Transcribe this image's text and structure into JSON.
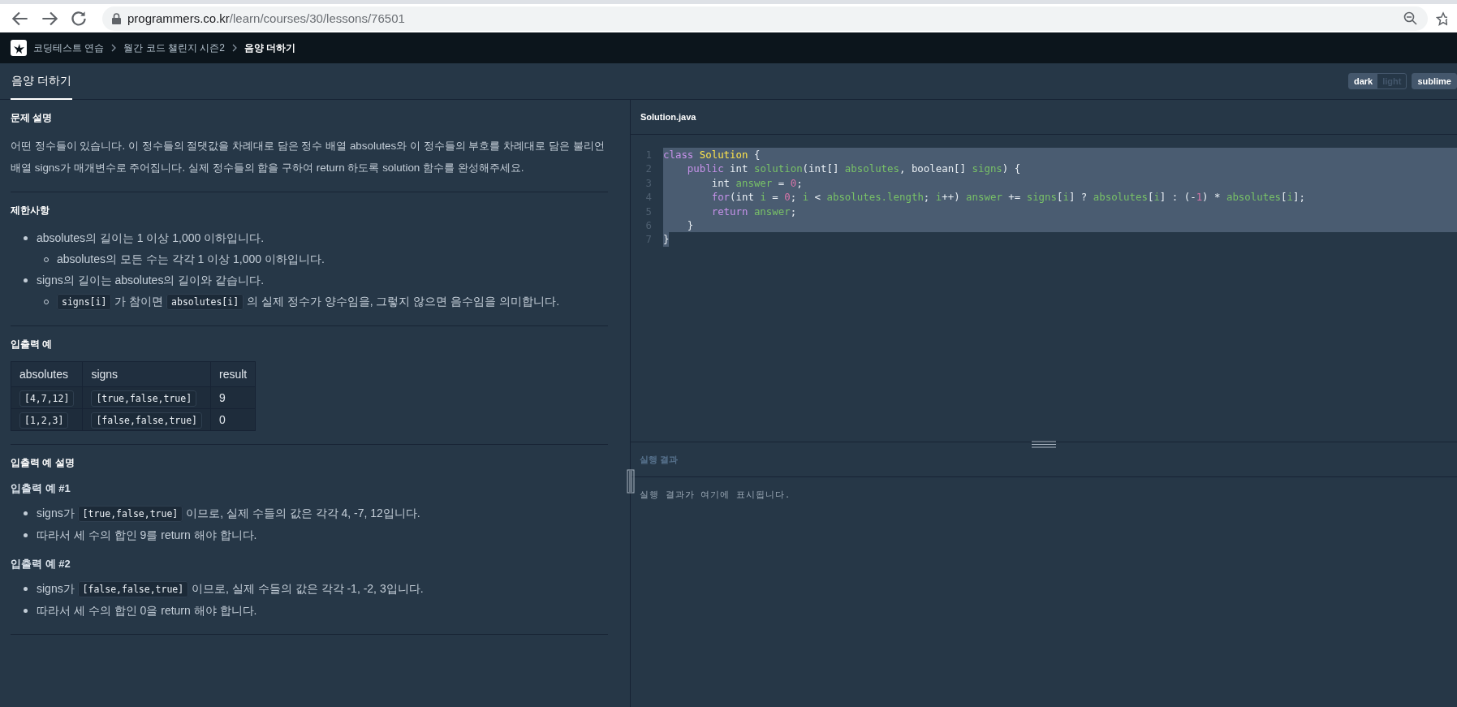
{
  "browser": {
    "url_domain": "programmers.co.kr",
    "url_path": "/learn/courses/30/lessons/76501"
  },
  "nav": {
    "breadcrumbs": [
      {
        "label": "코딩테스트 연습",
        "current": false
      },
      {
        "label": "월간 코드 챌린지 시즌2",
        "current": false
      },
      {
        "label": "음양 더하기",
        "current": true
      }
    ]
  },
  "title_bar": {
    "tab": "음양 더하기",
    "theme_toggle": [
      {
        "label": "dark",
        "selected": true
      },
      {
        "label": "light",
        "selected": false
      }
    ],
    "editor_toggle": [
      {
        "label": "sublime",
        "selected": true
      }
    ]
  },
  "problem": {
    "sections": [
      {
        "kind": "text",
        "heading": "문제 설명",
        "paragraphs": [
          "어떤 정수들이 있습니다. 이 정수들의 절댓값을 차례대로 담은 정수 배열 absolutes와 이 정수들의 부호를 차례대로 담은 불리언 배열 signs가 매개변수로 주어집니다. 실제 정수들의 합을 구하여 return 하도록 solution 함수를 완성해주세요."
        ]
      },
      {
        "kind": "list",
        "heading": "제한사항",
        "items": [
          {
            "segments": [
              {
                "text": "absolutes의 길이는 1 이상 1,000 이하입니다.",
                "code": false
              }
            ],
            "children": [
              {
                "segments": [
                  {
                    "text": "absolutes의 모든 수는 각각 1 이상 1,000 이하입니다.",
                    "code": false
                  }
                ]
              }
            ]
          },
          {
            "segments": [
              {
                "text": "signs의 길이는 absolutes의 길이와 같습니다.",
                "code": false
              }
            ],
            "children": [
              {
                "segments": [
                  {
                    "text": "signs[i]",
                    "code": true
                  },
                  {
                    "text": " 가 참이면 ",
                    "code": false
                  },
                  {
                    "text": "absolutes[i]",
                    "code": true
                  },
                  {
                    "text": " 의 실제 정수가 양수임을, 그렇지 않으면 음수임을 의미합니다.",
                    "code": false
                  }
                ]
              }
            ]
          }
        ]
      },
      {
        "kind": "table",
        "heading": "입출력 예",
        "columns": [
          "absolutes",
          "signs",
          "result"
        ],
        "rows": [
          [
            {
              "text": "[4,7,12]",
              "code": true
            },
            {
              "text": "[true,false,true]",
              "code": true
            },
            {
              "text": "9",
              "code": false
            }
          ],
          [
            {
              "text": "[1,2,3]",
              "code": true
            },
            {
              "text": "[false,false,true]",
              "code": true
            },
            {
              "text": "0",
              "code": false
            }
          ]
        ]
      },
      {
        "kind": "examples",
        "heading": "입출력 예 설명",
        "examples": [
          {
            "title": "입출력 예 #1",
            "items": [
              {
                "segments": [
                  {
                    "text": "signs가 ",
                    "code": false
                  },
                  {
                    "text": "[true,false,true]",
                    "code": true
                  },
                  {
                    "text": " 이므로, 실제 수들의 값은 각각 4, -7, 12입니다.",
                    "code": false
                  }
                ]
              },
              {
                "segments": [
                  {
                    "text": "따라서 세 수의 합인 9를 return 해야 합니다.",
                    "code": false
                  }
                ]
              }
            ]
          },
          {
            "title": "입출력 예 #2",
            "items": [
              {
                "segments": [
                  {
                    "text": "signs가 ",
                    "code": false
                  },
                  {
                    "text": "[false,false,true]",
                    "code": true
                  },
                  {
                    "text": " 이므로, 실제 수들의 값은 각각 -1, -2, 3입니다.",
                    "code": false
                  }
                ]
              },
              {
                "segments": [
                  {
                    "text": "따라서 세 수의 합인 0을 return 해야 합니다.",
                    "code": false
                  }
                ]
              }
            ]
          }
        ]
      }
    ]
  },
  "editor": {
    "filename": "Solution.java",
    "lines": [
      {
        "number": "1",
        "selected": true,
        "to_line_end": true,
        "tokens": [
          {
            "t": "class",
            "kind": "keyword"
          },
          {
            "t": " Solution",
            "kind": "class"
          },
          {
            "t": " {",
            "kind": "plain"
          }
        ]
      },
      {
        "number": "2",
        "selected": true,
        "to_line_end": true,
        "tokens": [
          {
            "t": "    public",
            "kind": "keyword"
          },
          {
            "t": " int ",
            "kind": "plain"
          },
          {
            "t": "solution",
            "kind": "name"
          },
          {
            "t": "(int[] ",
            "kind": "plain"
          },
          {
            "t": "absolutes",
            "kind": "name"
          },
          {
            "t": ", boolean[] ",
            "kind": "plain"
          },
          {
            "t": "signs",
            "kind": "name"
          },
          {
            "t": ") {",
            "kind": "plain"
          }
        ]
      },
      {
        "number": "3",
        "selected": true,
        "to_line_end": true,
        "tokens": [
          {
            "t": "        int ",
            "kind": "plain"
          },
          {
            "t": "answer",
            "kind": "name"
          },
          {
            "t": " = ",
            "kind": "plain"
          },
          {
            "t": "0",
            "kind": "number"
          },
          {
            "t": ";",
            "kind": "plain"
          }
        ]
      },
      {
        "number": "4",
        "selected": true,
        "to_line_end": true,
        "tokens": [
          {
            "t": "        for",
            "kind": "keyword"
          },
          {
            "t": "(int ",
            "kind": "plain"
          },
          {
            "t": "i",
            "kind": "name"
          },
          {
            "t": " = ",
            "kind": "plain"
          },
          {
            "t": "0",
            "kind": "number"
          },
          {
            "t": "; ",
            "kind": "plain"
          },
          {
            "t": "i",
            "kind": "name"
          },
          {
            "t": " < ",
            "kind": "plain"
          },
          {
            "t": "absolutes.length",
            "kind": "name"
          },
          {
            "t": "; ",
            "kind": "plain"
          },
          {
            "t": "i",
            "kind": "name"
          },
          {
            "t": "++) ",
            "kind": "plain"
          },
          {
            "t": "answer",
            "kind": "name"
          },
          {
            "t": " += ",
            "kind": "plain"
          },
          {
            "t": "signs",
            "kind": "name"
          },
          {
            "t": "[",
            "kind": "plain"
          },
          {
            "t": "i",
            "kind": "name"
          },
          {
            "t": "] ? ",
            "kind": "plain"
          },
          {
            "t": "absolutes",
            "kind": "name"
          },
          {
            "t": "[",
            "kind": "plain"
          },
          {
            "t": "i",
            "kind": "name"
          },
          {
            "t": "] : (-",
            "kind": "plain"
          },
          {
            "t": "1",
            "kind": "number"
          },
          {
            "t": ") * ",
            "kind": "plain"
          },
          {
            "t": "absolutes",
            "kind": "name"
          },
          {
            "t": "[",
            "kind": "plain"
          },
          {
            "t": "i",
            "kind": "name"
          },
          {
            "t": "];",
            "kind": "plain"
          }
        ]
      },
      {
        "number": "5",
        "selected": true,
        "to_line_end": true,
        "tokens": [
          {
            "t": "        return",
            "kind": "keyword"
          },
          {
            "t": " answer",
            "kind": "name"
          },
          {
            "t": ";",
            "kind": "plain"
          }
        ]
      },
      {
        "number": "6",
        "selected": true,
        "to_line_end": true,
        "tokens": [
          {
            "t": "    }",
            "kind": "plain"
          }
        ]
      },
      {
        "number": "7",
        "selected": true,
        "to_line_end": false,
        "tokens": [
          {
            "t": "}",
            "kind": "plain"
          }
        ]
      }
    ]
  },
  "result": {
    "title": "실행 결과",
    "output": "실행 결과가 여기에 표시됩니다."
  }
}
